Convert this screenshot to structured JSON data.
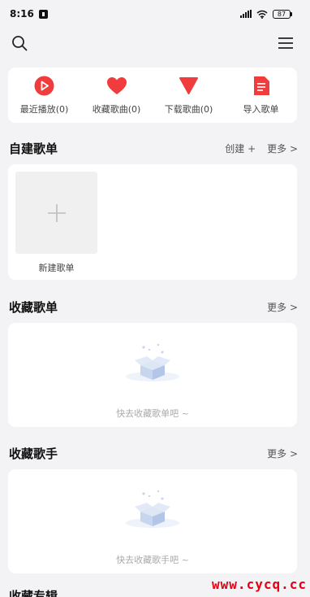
{
  "status_bar": {
    "time": "8:16",
    "battery": "87"
  },
  "quick_actions": [
    {
      "label": "最近播放(0)",
      "icon": "play-circle-icon",
      "color": "#f03c3c"
    },
    {
      "label": "收藏歌曲(0)",
      "icon": "heart-icon",
      "color": "#f03c3c"
    },
    {
      "label": "下载歌曲(0)",
      "icon": "download-triangle-icon",
      "color": "#f03c3c"
    },
    {
      "label": "导入歌单",
      "icon": "document-icon",
      "color": "#f03c3c"
    }
  ],
  "my_playlists": {
    "title": "自建歌单",
    "create_label": "创建 +",
    "more_label": "更多 >",
    "new_playlist_label": "新建歌单"
  },
  "collected_playlists": {
    "title": "收藏歌单",
    "more_label": "更多 >",
    "empty_text": "快去收藏歌单吧 ~"
  },
  "collected_artists": {
    "title": "收藏歌手",
    "more_label": "更多 >",
    "empty_text": "快去收藏歌手吧 ~"
  },
  "next_section_title_partial": "收藏专辑",
  "watermark": "www.cycq.cc",
  "accent_color": "#f03c3c"
}
